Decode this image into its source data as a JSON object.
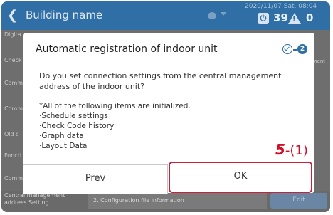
{
  "header": {
    "title": "Building name",
    "datetime": "2020/11/07 Sat. 08:04",
    "power_count": "39",
    "warning_count": "0",
    "power_glyph": "⏻",
    "warning_glyph": "!"
  },
  "background": {
    "rows": [
      {
        "label": "Digita"
      },
      {
        "label": "Check"
      },
      {
        "label": "Comm"
      },
      {
        "label": "Comm"
      },
      {
        "label": "Old c"
      },
      {
        "label": "Functi"
      },
      {
        "label": "Comm"
      }
    ],
    "right_fragment": "gement",
    "bottom_label": "Central management address Setting",
    "bottom_field": "2. Configuration file information",
    "bottom_button": "Edit"
  },
  "dialog": {
    "title": "Automatic registration of indoor unit",
    "step_number": "2",
    "question": "Do you set connection settings from the central management address of the indoor unit?",
    "note_heading": "*All of the following items are initialized.",
    "note_items": [
      "·Schedule settings",
      "·Check Code history",
      "·Graph data",
      "·Layout Data"
    ],
    "prev_label": "Prev",
    "ok_label": "OK"
  },
  "annotation": {
    "step": "5",
    "sub": "-(1)",
    "color": "#d0102a"
  },
  "colors": {
    "header": "#2f6fa6",
    "accent": "#2f6fa6",
    "highlight": "#c9213a"
  }
}
